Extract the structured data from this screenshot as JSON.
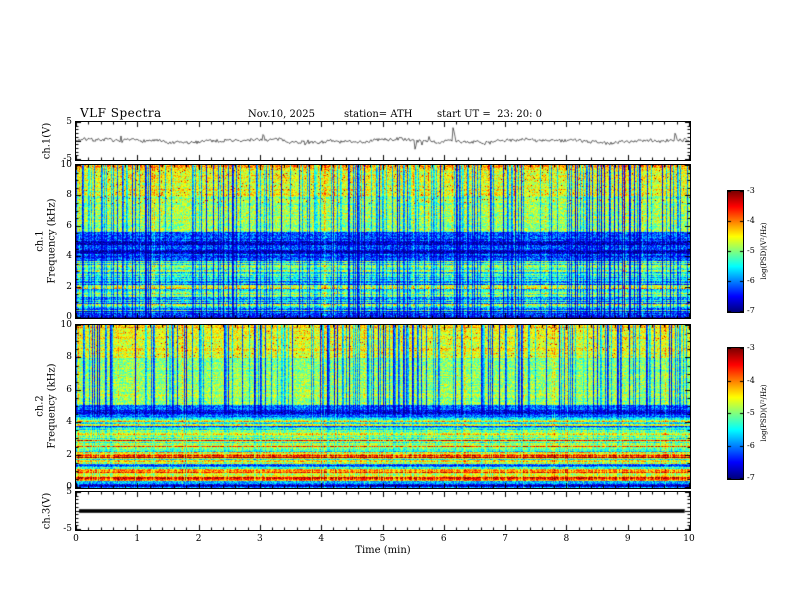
{
  "header": {
    "title": "VLF Spectra",
    "date": "Nov.10, 2025",
    "station": "station= ATH",
    "start_ut": "start UT =  23: 20: 0"
  },
  "x_axis": {
    "label": "Time (min)",
    "lim": [
      0,
      10
    ],
    "major_ticks": [
      0,
      1,
      2,
      3,
      4,
      5,
      6,
      7,
      8,
      9,
      10
    ],
    "minor_step": 0.2
  },
  "chart_data": [
    {
      "id": "ch1_waveform",
      "type": "line",
      "ylabel": "ch.1(V)",
      "ylim": [
        -5,
        5
      ],
      "yticks": [
        5,
        -5
      ],
      "xlim_min": [
        0,
        10
      ],
      "signal": {
        "kind": "broadband-noise",
        "mean": 0,
        "noise_amp": 0.45,
        "wobble_amp": 0.35,
        "spike_rate": 0.02,
        "spike_max": 4.5
      }
    },
    {
      "id": "ch1_spectrogram",
      "type": "heatmap",
      "ylabel": "ch.1\nFrequency (kHz)",
      "ylim": [
        0,
        10
      ],
      "yticks": [
        0,
        2,
        4,
        6,
        8,
        10
      ],
      "zlabel": "log(PSD)(V²/Hz)",
      "zlim": [
        -7,
        -3
      ],
      "zticks": [
        -3,
        -4,
        -5,
        -6,
        -7
      ],
      "bands": [
        {
          "f": [
            0,
            0.4
          ],
          "level": -6.5
        },
        {
          "f": [
            0.4,
            2.6
          ],
          "level": -5.7
        },
        {
          "f": [
            2.6,
            3.7
          ],
          "level": -5.1
        },
        {
          "f": [
            3.7,
            5.6
          ],
          "level": -6.2
        },
        {
          "f": [
            5.6,
            8
          ],
          "level": -4.9
        },
        {
          "f": [
            8,
            10
          ],
          "level": -4.6
        }
      ],
      "lines": [
        {
          "f": 0.8,
          "level": -5.0,
          "width": 0.1
        },
        {
          "f": 1.5,
          "level": -5.2,
          "width": 0.08
        },
        {
          "f": 2.0,
          "level": -4.3,
          "width": 0.14
        },
        {
          "f": 2.35,
          "level": -5.4,
          "width": 0.08
        },
        {
          "f": 4.3,
          "level": -6.7,
          "width": 0.12
        },
        {
          "f": 4.9,
          "level": -6.6,
          "width": 0.1
        },
        {
          "f": 9.95,
          "level": -4.2,
          "width": 0.1
        }
      ],
      "striping": {
        "f_max": 3.7,
        "amp": 0.7
      },
      "streaks": {
        "rate": 0.28,
        "min_level": -6.9,
        "f_above": 0
      },
      "hot_specks": {
        "rate": 0.02,
        "level": -3.3,
        "f_range": [
          7.5,
          10
        ]
      },
      "noise": 0.5
    },
    {
      "id": "ch2_spectrogram",
      "type": "heatmap",
      "ylabel": "ch.2\nFrequency (kHz)",
      "ylim": [
        0,
        10
      ],
      "yticks": [
        0,
        2,
        4,
        6,
        8,
        10
      ],
      "zlabel": "log(PSD)(V²/Hz)",
      "zlim": [
        -7,
        -3
      ],
      "zticks": [
        -3,
        -4,
        -5,
        -6,
        -7
      ],
      "bands": [
        {
          "f": [
            0,
            0.3
          ],
          "level": -6.2
        },
        {
          "f": [
            0.3,
            4.3
          ],
          "level": -4.9
        },
        {
          "f": [
            4.3,
            5.1
          ],
          "level": -6.0
        },
        {
          "f": [
            5.1,
            8
          ],
          "level": -4.9
        },
        {
          "f": [
            8,
            10
          ],
          "level": -4.6
        }
      ],
      "lines": [
        {
          "f": 0.55,
          "level": -3.9,
          "width": 0.12
        },
        {
          "f": 0.95,
          "level": -4.2,
          "width": 0.1
        },
        {
          "f": 1.35,
          "level": -5.6,
          "width": 0.08
        },
        {
          "f": 1.95,
          "level": -3.4,
          "width": 0.12
        },
        {
          "f": 2.5,
          "level": -4.4,
          "width": 0.08
        },
        {
          "f": 2.9,
          "level": -4.0,
          "width": 0.1
        },
        {
          "f": 3.4,
          "level": -4.5,
          "width": 0.08
        },
        {
          "f": 3.75,
          "level": -5.8,
          "width": 0.07
        },
        {
          "f": 4.65,
          "level": -6.6,
          "width": 0.12
        },
        {
          "f": 9.95,
          "level": -4.3,
          "width": 0.1
        }
      ],
      "striping": {
        "f_max": 4.3,
        "amp": 0.85
      },
      "streaks": {
        "rate": 0.26,
        "min_level": -6.9,
        "f_above": 4.5
      },
      "hot_specks": {
        "rate": 0.015,
        "level": -3.4,
        "f_range": [
          8,
          10
        ]
      },
      "noise": 0.45
    },
    {
      "id": "ch3_waveform",
      "type": "line",
      "ylabel": "ch.3(V)",
      "ylim": [
        -5,
        5
      ],
      "yticks": [
        5,
        -5
      ],
      "signal": {
        "kind": "flat-saturated",
        "value": 0,
        "bar_halfwidth_v": 0.5,
        "x_start": 0.05,
        "x_end": 9.93
      }
    }
  ]
}
